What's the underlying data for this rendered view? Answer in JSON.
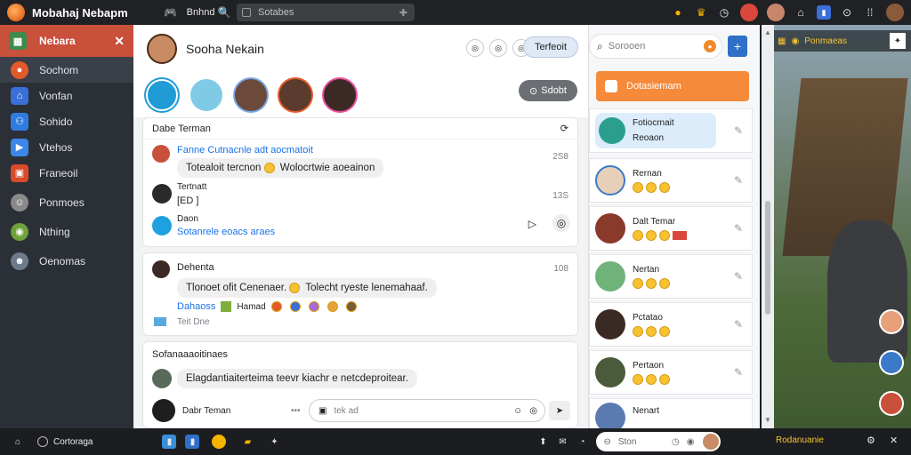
{
  "app": {
    "title": "Mobahaj Nebapm"
  },
  "topbar": {
    "menu_label": "Bnhnd",
    "search_placeholder": "Sotabes"
  },
  "sidebar": {
    "header": "Nebara",
    "items": [
      {
        "label": "Sochom",
        "icon": "fire-icon",
        "color": "#e25a2b"
      },
      {
        "label": "Vonfan",
        "icon": "home-icon",
        "color": "#3b6fd8"
      },
      {
        "label": "Sohido",
        "icon": "group-icon",
        "color": "#2f7ce0"
      },
      {
        "label": "Vtehos",
        "icon": "video-icon",
        "color": "#3c87e6"
      },
      {
        "label": "Franeoil",
        "icon": "store-icon",
        "color": "#d84a2a"
      },
      {
        "label": "Ponmoes",
        "icon": "avatar-icon",
        "color": "#8a8a8a"
      },
      {
        "label": "Nthing",
        "icon": "game-icon",
        "color": "#6da33a"
      },
      {
        "label": "Oenomas",
        "icon": "profile-icon",
        "color": "#6e7a8a"
      }
    ]
  },
  "main": {
    "profile_name": "Sooha Nekain",
    "friend_label": "Terfeoit",
    "start_button": "Sdobt",
    "card1": {
      "title": "Dabe Terman",
      "items": [
        {
          "link": "Fanne Cutnacnle adt aocmatoit",
          "time": "2S8",
          "bubble": "Totealoit tercnon",
          "bubble2": "Wolocrtwie aoeainon"
        },
        {
          "name": "Tertnatt",
          "time": "13S",
          "text": "[ED ]"
        },
        {
          "name": "Daon",
          "link": "Sotanrele eoacs araes"
        }
      ]
    },
    "card2": {
      "name": "Dehenta",
      "time": "108",
      "bubble": "Tlonoet ofit Cenenaer.",
      "bubble2": "Tolecht ryeste lenemahaaf.",
      "link": "Dahaoss",
      "tag": "Hamad",
      "footer": "Teit Dne"
    },
    "card3": {
      "title": "Sofanaaaoitinaes",
      "bubble": "Elagdantiaiterteima teevr kiachr e netcdeproitear.",
      "composer_name": "Dabr Teman",
      "composer_hint": "tek ad"
    }
  },
  "right_panel": {
    "search_placeholder": "Sorooen",
    "cta": "Dotasiemam",
    "contacts": [
      {
        "name": "Fotiocrnait",
        "sub": "Reoaon"
      },
      {
        "name": "Rernan",
        "sub": ""
      },
      {
        "name": "Dalt Temar",
        "sub": ""
      },
      {
        "name": "Nertan",
        "sub": ""
      },
      {
        "name": "Pctatao",
        "sub": ""
      },
      {
        "name": "Pertaon",
        "sub": ""
      },
      {
        "name": "Nenart",
        "sub": ""
      }
    ]
  },
  "scene": {
    "badge": "Ponmaeas",
    "bottom_caption": "Rodanuanie"
  },
  "bottombar": {
    "start_label": "Cortoraga",
    "search": "Ston"
  }
}
